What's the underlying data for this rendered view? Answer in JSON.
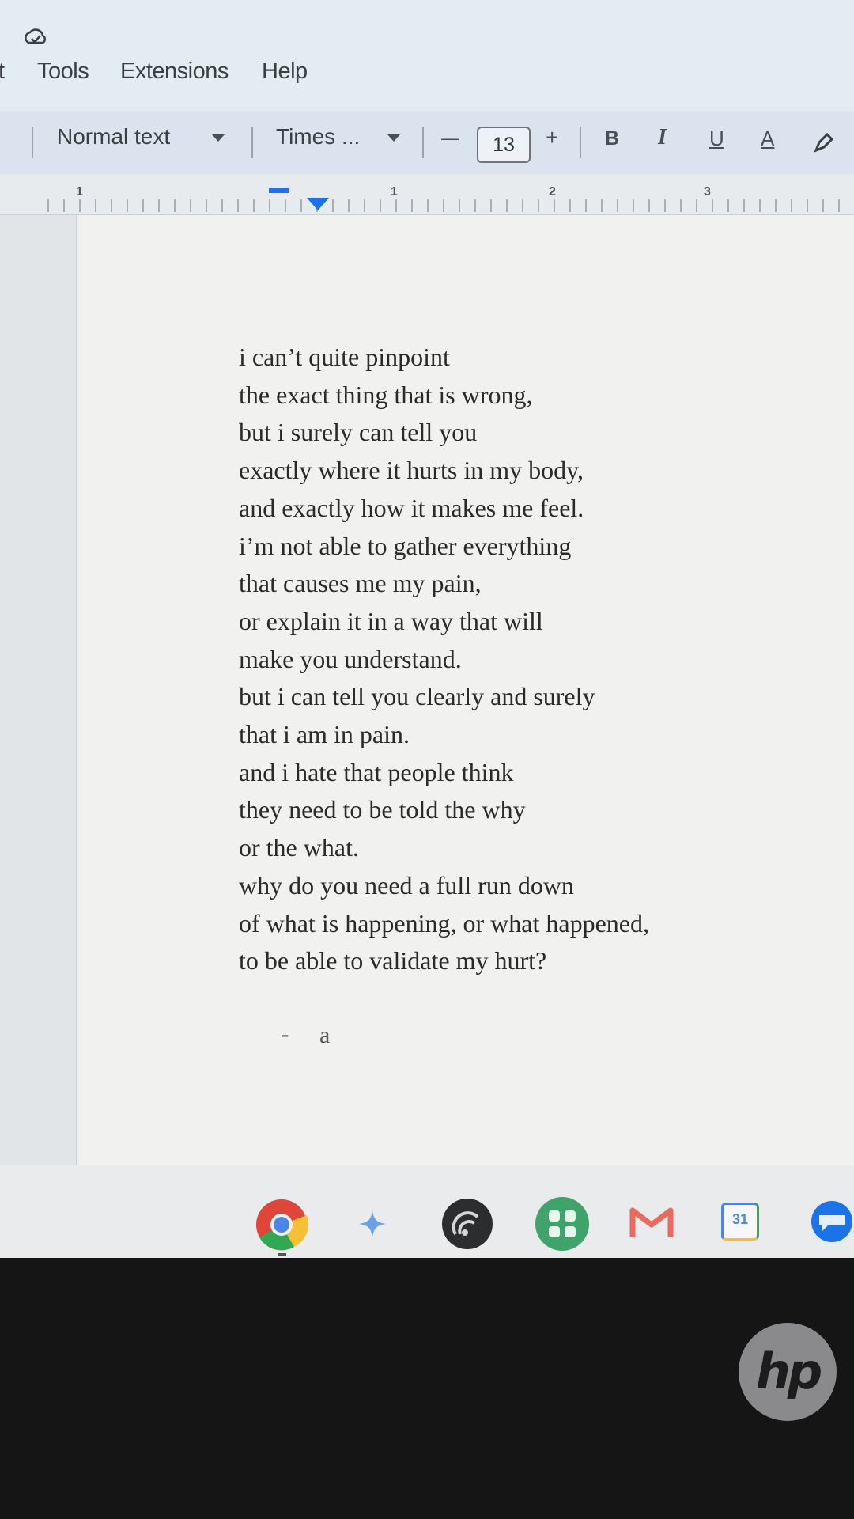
{
  "menubar": {
    "items": [
      {
        "label": "t"
      },
      {
        "label": "Tools"
      },
      {
        "label": "Extensions"
      },
      {
        "label": "Help"
      }
    ]
  },
  "toolbar": {
    "style_value": "Normal text",
    "font_value": "Times ...",
    "font_size": "13",
    "decrease_label": "—",
    "increase_label": "+",
    "bold_label": "B",
    "italic_label": "I",
    "underline_label": "U",
    "text_color_label": "A"
  },
  "ruler": {
    "numbers": [
      "1",
      "1",
      "2",
      "3"
    ]
  },
  "document": {
    "lines": [
      "i can’t quite pinpoint",
      "the exact thing that is wrong,",
      "but i surely can tell you",
      "exactly where it hurts in my body,",
      "and exactly how it makes me feel.",
      "i’m not able to gather everything",
      "that causes me my pain,",
      "or explain it in a way that will",
      "make you understand.",
      "but i can tell you clearly and surely",
      "that i am in pain.",
      "and i hate that people think",
      "they need to be told the why",
      "or the what.",
      "why do you need a full run down",
      "of what is happening, or what happened,",
      "to be able to validate my hurt?"
    ],
    "signoff_dash": "-",
    "signoff_letter": "a"
  },
  "shelf": {
    "apps": [
      "chrome-icon",
      "gemini-icon",
      "podcast-icon",
      "apps-icon",
      "gmail-icon",
      "calendar-icon",
      "chat-icon"
    ],
    "calendar_day": "31"
  },
  "bezel": {
    "logo_text": "hp"
  },
  "colors": {
    "accent": "#1a73e8",
    "page": "#f1f2f0",
    "toolbar": "#dbe3ee"
  }
}
